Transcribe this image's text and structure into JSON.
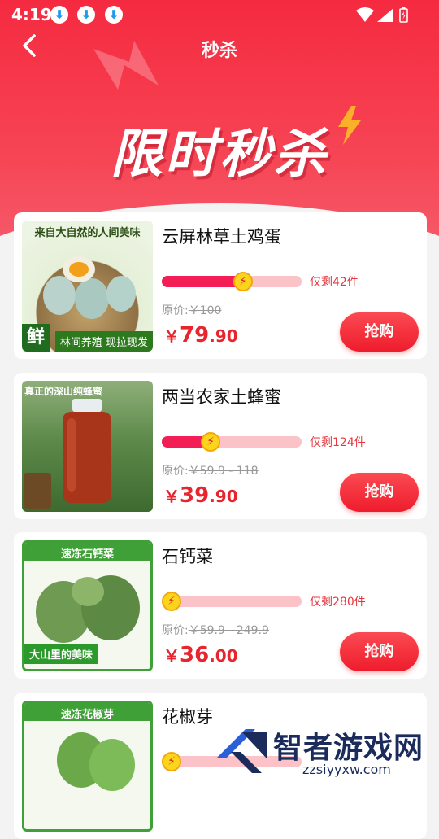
{
  "status_bar": {
    "time": "4:19",
    "download_icon": "⬇"
  },
  "header": {
    "title": "秒杀"
  },
  "banner": {
    "text": "限时秒杀"
  },
  "common": {
    "original_label": "原价:",
    "yen": "￥",
    "buy_label": "抢购",
    "bolt": "⚡"
  },
  "products": [
    {
      "name": "云屏林草土鸡蛋",
      "remaining": "仅剩42件",
      "progress": 0.58,
      "original_price": "￥100",
      "price_int": "79",
      "price_dec": ".90",
      "image": {
        "caption": "来自大自然的人间美味",
        "subcaption": "林间养殖 现拉现发",
        "badge": "鲜"
      }
    },
    {
      "name": "两当农家土蜂蜜",
      "remaining": "仅剩124件",
      "progress": 0.35,
      "original_price": "￥59.9 - 118",
      "price_int": "39",
      "price_dec": ".90",
      "image": {
        "caption": "真正的深山纯蜂蜜"
      }
    },
    {
      "name": "石钙菜",
      "remaining": "仅剩280件",
      "progress": 0.0,
      "original_price": "￥59.9 - 249.9",
      "price_int": "36",
      "price_dec": ".00",
      "image": {
        "caption": "速冻石钙菜",
        "subcaption": "大山里的美味"
      }
    },
    {
      "name": "花椒芽",
      "remaining": "",
      "progress": 0.0,
      "original_price": "",
      "price_int": "",
      "price_dec": "",
      "image": {
        "caption": "速冻花椒芽"
      }
    }
  ],
  "watermark": {
    "text": "智者游戏网",
    "url": "zzsiyyxw.com"
  }
}
